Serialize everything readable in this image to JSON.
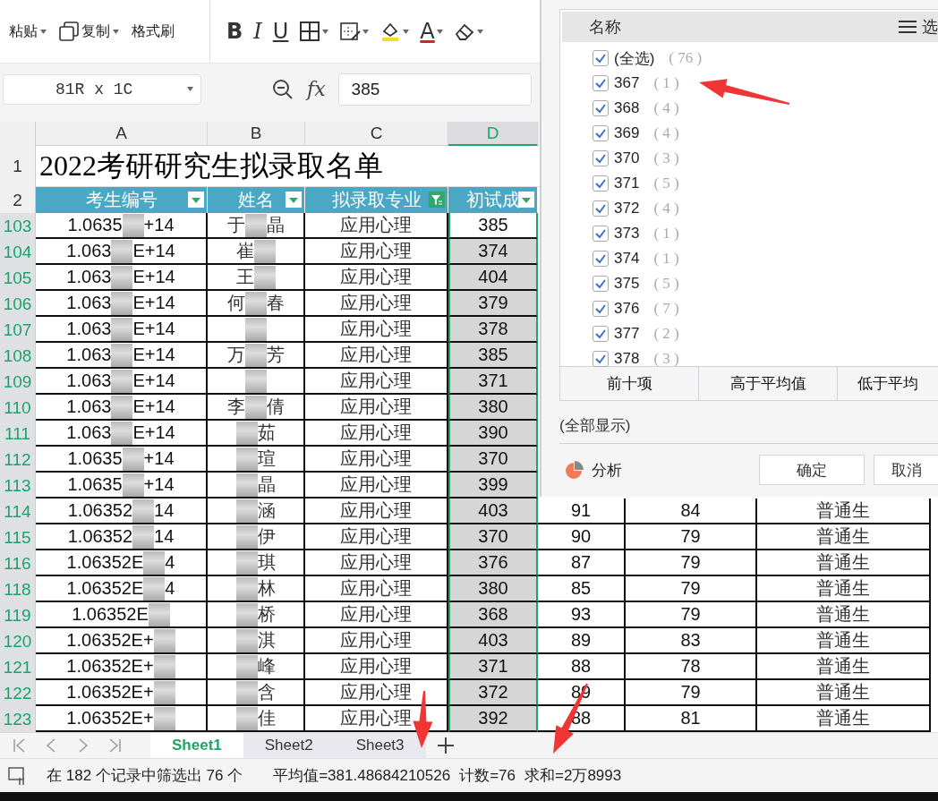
{
  "ribbon": {
    "clipboard": [
      {
        "label": "粘贴",
        "kind": "paste",
        "dropdown": true
      },
      {
        "label": "复制",
        "kind": "copy",
        "dropdown": true
      },
      {
        "label": "格式刷",
        "kind": "brush",
        "dropdown": false
      }
    ],
    "font_tools": [
      {
        "kind": "bold",
        "glyph": "B",
        "dropdown": false
      },
      {
        "kind": "italic",
        "glyph": "I",
        "dropdown": false
      },
      {
        "kind": "underline",
        "glyph": "U",
        "dropdown": false
      },
      {
        "kind": "borders",
        "dropdown": true
      },
      {
        "kind": "cell-style",
        "dropdown": true
      },
      {
        "kind": "fill",
        "dropdown": true
      },
      {
        "kind": "font-color",
        "glyph": "A",
        "dropdown": true
      },
      {
        "kind": "clear",
        "dropdown": true
      }
    ]
  },
  "formula_bar": {
    "name_box": "81R x 1C",
    "fx": "fx",
    "value": "385"
  },
  "sheet": {
    "columns": [
      {
        "label": "A",
        "selected": false
      },
      {
        "label": "B",
        "selected": false
      },
      {
        "label": "C",
        "selected": false
      },
      {
        "label": "D",
        "selected": true
      }
    ],
    "title_row": {
      "number": "1",
      "text": "2022考研研究生拟录取名单"
    },
    "header_row": {
      "number": "2",
      "cells": [
        {
          "text": "考生编号",
          "filter_active": false
        },
        {
          "text": "姓名",
          "filter_active": false
        },
        {
          "text": "拟录取专业",
          "filter_active": true
        },
        {
          "text": "初试成",
          "filter_active": false
        }
      ]
    },
    "rows": [
      {
        "number": "103",
        "id": {
          "start": "1.0635",
          "end": "+14"
        },
        "name": {
          "start": "于",
          "end": "晶"
        },
        "major": "应用心理",
        "score": "385",
        "active": true
      },
      {
        "number": "104",
        "id": {
          "start": "1.063",
          "end": "E+14"
        },
        "name": {
          "start": "崔"
        },
        "major": "应用心理",
        "score": "374",
        "active": false
      },
      {
        "number": "105",
        "id": {
          "start": "1.063",
          "end": "E+14"
        },
        "name": {
          "start": "王"
        },
        "major": "应用心理",
        "score": "404",
        "active": false
      },
      {
        "number": "106",
        "id": {
          "start": "1.063",
          "end": "E+14"
        },
        "name": {
          "start": "何",
          "end": "春"
        },
        "major": "应用心理",
        "score": "379",
        "active": false
      },
      {
        "number": "107",
        "id": {
          "start": "1.063",
          "end": "E+14"
        },
        "name": {},
        "major": "应用心理",
        "score": "378",
        "active": false
      },
      {
        "number": "108",
        "id": {
          "start": "1.063",
          "end": "E+14"
        },
        "name": {
          "start": "万",
          "end": "芳"
        },
        "major": "应用心理",
        "score": "385",
        "active": false
      },
      {
        "number": "109",
        "id": {
          "start": "1.063",
          "end": "E+14"
        },
        "name": {},
        "major": "应用心理",
        "score": "371",
        "active": false
      },
      {
        "number": "110",
        "id": {
          "start": "1.063",
          "end": "E+14"
        },
        "name": {
          "start": "李",
          "end": "倩"
        },
        "major": "应用心理",
        "score": "380",
        "active": false
      },
      {
        "number": "111",
        "id": {
          "start": "1.063",
          "end": "E+14"
        },
        "name": {
          "end": "茹"
        },
        "major": "应用心理",
        "score": "390",
        "active": false
      },
      {
        "number": "112",
        "id": {
          "start": "1.0635",
          "end": "+14"
        },
        "name": {
          "end": "瑄"
        },
        "major": "应用心理",
        "score": "370",
        "active": false
      },
      {
        "number": "113",
        "id": {
          "start": "1.0635",
          "end": "+14"
        },
        "name": {
          "end": "晶"
        },
        "major": "应用心理",
        "score": "399",
        "active": false
      },
      {
        "number": "114",
        "id": {
          "start": "1.06352",
          "end": "14"
        },
        "name": {
          "end": "涵"
        },
        "major": "应用心理",
        "score": "403",
        "active": false,
        "e": "91",
        "f": "84",
        "g": "普通生"
      },
      {
        "number": "115",
        "id": {
          "start": "1.06352",
          "end": "14"
        },
        "name": {
          "end": "伊"
        },
        "major": "应用心理",
        "score": "370",
        "active": false,
        "e": "90",
        "f": "79",
        "g": "普通生"
      },
      {
        "number": "116",
        "id": {
          "start": "1.06352E",
          "end": "4"
        },
        "name": {
          "end": "琪"
        },
        "major": "应用心理",
        "score": "376",
        "active": false,
        "e": "87",
        "f": "79",
        "g": "普通生"
      },
      {
        "number": "118",
        "id": {
          "start": "1.06352E",
          "end": "4"
        },
        "name": {
          "end": "林"
        },
        "major": "应用心理",
        "score": "380",
        "active": false,
        "e": "85",
        "f": "79",
        "g": "普通生"
      },
      {
        "number": "119",
        "id": {
          "start": "1.06352E"
        },
        "name": {
          "end": "桥"
        },
        "major": "应用心理",
        "score": "368",
        "active": false,
        "e": "93",
        "f": "79",
        "g": "普通生"
      },
      {
        "number": "120",
        "id": {
          "start": "1.06352E+"
        },
        "name": {
          "end": "淇"
        },
        "major": "应用心理",
        "score": "403",
        "active": false,
        "e": "89",
        "f": "83",
        "g": "普通生"
      },
      {
        "number": "121",
        "id": {
          "start": "1.06352E+"
        },
        "name": {
          "end": "峰"
        },
        "major": "应用心理",
        "score": "371",
        "active": false,
        "e": "88",
        "f": "78",
        "g": "普通生"
      },
      {
        "number": "122",
        "id": {
          "start": "1.06352E+"
        },
        "name": {
          "end": "含"
        },
        "major": "应用心理",
        "score": "372",
        "active": false,
        "e": "89",
        "f": "79",
        "g": "普通生"
      },
      {
        "number": "123",
        "id": {
          "start": "1.06352E+"
        },
        "name": {
          "end": "佳"
        },
        "major": "应用心理",
        "score": "392",
        "active": false,
        "e": "88",
        "f": "81",
        "g": "普通生"
      }
    ]
  },
  "filter_dialog": {
    "list_header": "名称",
    "menu_label": "选",
    "items": [
      {
        "label": "(全选)",
        "count": "( 76 )",
        "checked": true
      },
      {
        "label": "367",
        "count": "( 1 )",
        "checked": true
      },
      {
        "label": "368",
        "count": "( 4 )",
        "checked": true
      },
      {
        "label": "369",
        "count": "( 4 )",
        "checked": true
      },
      {
        "label": "370",
        "count": "( 3 )",
        "checked": true
      },
      {
        "label": "371",
        "count": "( 5 )",
        "checked": true
      },
      {
        "label": "372",
        "count": "( 4 )",
        "checked": true
      },
      {
        "label": "373",
        "count": "( 1 )",
        "checked": true
      },
      {
        "label": "374",
        "count": "( 1 )",
        "checked": true
      },
      {
        "label": "375",
        "count": "( 5 )",
        "checked": true
      },
      {
        "label": "376",
        "count": "( 7 )",
        "checked": true
      },
      {
        "label": "377",
        "count": "( 2 )",
        "checked": true
      },
      {
        "label": "378",
        "count": "( 3 )",
        "checked": true
      }
    ],
    "quick_buttons": [
      "前十项",
      "高于平均值",
      "低于平均"
    ],
    "show_all": "(全部显示)",
    "analysis": "分析",
    "buttons": [
      "确定",
      "取消"
    ]
  },
  "sheet_tabs": [
    {
      "label": "Sheet1",
      "selected": true
    },
    {
      "label": "Sheet2",
      "selected": false
    },
    {
      "label": "Sheet3",
      "selected": false
    }
  ],
  "status_bar": {
    "filter_info": "在 182 个记录中筛选出 76 个",
    "average": "平均值=381.48684210526",
    "count": "计数=76",
    "sum": "求和=2万8993"
  }
}
